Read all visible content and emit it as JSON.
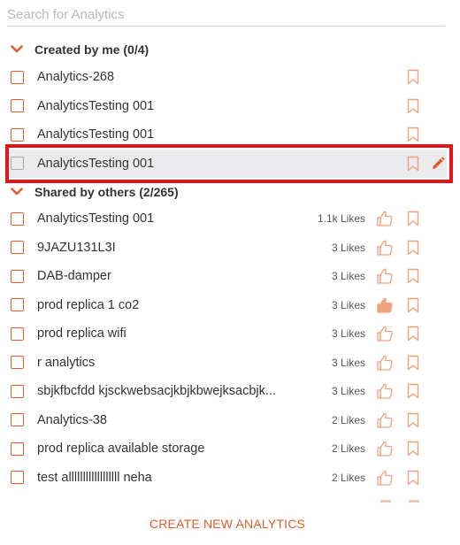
{
  "search": {
    "placeholder": "Search for Analytics"
  },
  "created_section": {
    "label": "Created by me (0/4)"
  },
  "created_items": [
    {
      "name": "Analytics-268"
    },
    {
      "name": "AnalyticsTesting 001"
    },
    {
      "name": "AnalyticsTesting 001"
    },
    {
      "name": "AnalyticsTesting 001",
      "selected": true
    }
  ],
  "shared_section": {
    "label": "Shared by others (2/265)"
  },
  "shared_items": [
    {
      "name": "AnalyticsTesting 001",
      "likes": "1.1k Likes",
      "liked": false
    },
    {
      "name": "9JAZU131L3I",
      "likes": "3 Likes",
      "liked": false
    },
    {
      "name": "DAB-damper",
      "likes": "3 Likes",
      "liked": false
    },
    {
      "name": "prod replica 1 co2",
      "likes": "3 Likes",
      "liked": true
    },
    {
      "name": "prod replica wifi",
      "likes": "3 Likes",
      "liked": false
    },
    {
      "name": "r analytics",
      "likes": "3 Likes",
      "liked": false
    },
    {
      "name": "sbjkfbcfdd kjsckwebsacjkbjkbwejksacbjk...",
      "likes": "3 Likes",
      "liked": false
    },
    {
      "name": "Analytics-38",
      "likes": "2 Likes",
      "liked": false
    },
    {
      "name": "prod replica available storage",
      "likes": "2 Likes",
      "liked": false
    },
    {
      "name": "test allllllllllllllllll neha",
      "likes": "2 Likes",
      "liked": false
    }
  ],
  "footer": {
    "create_label": "CREATE NEW ANALYTICS"
  },
  "icons": {
    "checkbox": "checkbox-icon",
    "bookmark": "bookmark-icon",
    "thumbs_up": "thumbs-up-icon",
    "edit": "pencil-icon",
    "chevron": "chevron-down-icon"
  },
  "colors": {
    "accent": "#e35d2b",
    "icon_light": "#f0a27f",
    "selected_bg": "#ebebed",
    "highlight_border": "#e3141c"
  }
}
